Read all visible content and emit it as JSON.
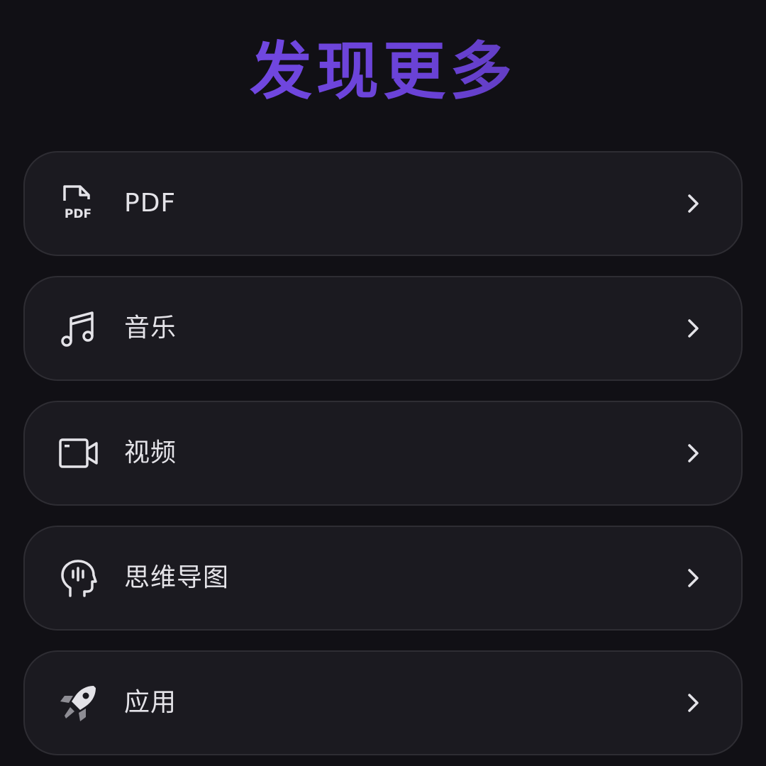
{
  "header": {
    "title": "发现更多"
  },
  "colors": {
    "background": "#111015",
    "card": "#1b1a20",
    "card_border": "#2e2d33",
    "text": "#e4e3e8",
    "title_gradient_start": "#7a4ff0",
    "title_gradient_end": "#4e3392"
  },
  "menu": {
    "items": [
      {
        "label": "PDF",
        "icon": "pdf-file-icon",
        "pdf_icon_text": "PDF"
      },
      {
        "label": "音乐",
        "icon": "music-note-icon"
      },
      {
        "label": "视频",
        "icon": "video-camera-icon"
      },
      {
        "label": "思维导图",
        "icon": "mind-map-head-icon"
      },
      {
        "label": "应用",
        "icon": "rocket-icon"
      }
    ]
  }
}
